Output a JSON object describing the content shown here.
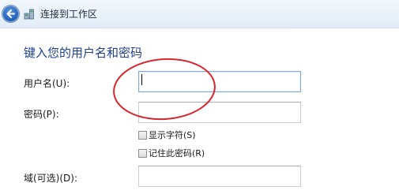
{
  "titlebar": {
    "title": "连接到工作区",
    "back_icon": "back-arrow-icon",
    "app_icon": "network-icon"
  },
  "heading": "键入您的用户名和密码",
  "form": {
    "username_label": "用户名(U):",
    "username_value": "",
    "password_label": "密码(P):",
    "password_value": "",
    "show_chars_label": "显示字符(S)",
    "show_chars_checked": false,
    "remember_label": "记住此密码(R)",
    "remember_checked": false,
    "domain_label": "域(可选)(D):",
    "domain_value": ""
  },
  "colors": {
    "heading": "#1f3f8b",
    "annotation": "#d9262e",
    "active_border": "#7ea8d8"
  }
}
